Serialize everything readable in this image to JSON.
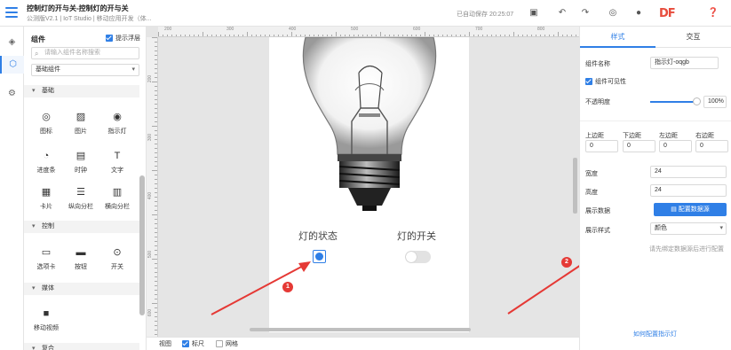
{
  "header": {
    "title": "控制灯的开与关-控制灯的开与关",
    "subtitle": "公测版V2.1 | IoT Studio | 移动应用开发（体...",
    "save_status": "已自动保存 20:25:07",
    "logo": "DF"
  },
  "component_panel": {
    "title": "组件",
    "float_tip_label": "提示浮层",
    "float_tip_checked": true,
    "search_placeholder": "请输入组件名称搜索",
    "category_select": "基础组件",
    "sections": [
      {
        "label": "基础",
        "items": [
          {
            "label": "图标",
            "icon": "target-icon"
          },
          {
            "label": "图片",
            "icon": "image-icon"
          },
          {
            "label": "指示灯",
            "icon": "indicator-icon"
          },
          {
            "label": "进度条",
            "icon": "progress-icon"
          },
          {
            "label": "时钟",
            "icon": "clock-icon"
          },
          {
            "label": "文字",
            "icon": "text-icon"
          },
          {
            "label": "卡片",
            "icon": "card-icon"
          },
          {
            "label": "纵向分栏",
            "icon": "rows-icon"
          },
          {
            "label": "横向分栏",
            "icon": "columns-icon"
          }
        ]
      },
      {
        "label": "控制",
        "items": [
          {
            "label": "选项卡",
            "icon": "tab-icon"
          },
          {
            "label": "按钮",
            "icon": "button-icon"
          },
          {
            "label": "开关",
            "icon": "switch-icon"
          }
        ]
      },
      {
        "label": "媒体",
        "items": [
          {
            "label": "移动视频",
            "icon": "video-icon"
          }
        ]
      },
      {
        "label": "复合",
        "items": []
      }
    ]
  },
  "canvas": {
    "ruler_top": [
      "200",
      "300",
      "400",
      "500",
      "600",
      "700",
      "800"
    ],
    "ruler_left": [
      "200",
      "300",
      "400",
      "500",
      "600"
    ],
    "state_label": "灯的状态",
    "switch_label": "灯的开关",
    "indicator_on": true,
    "switch_on": false,
    "badges": [
      "1",
      "2"
    ]
  },
  "bottom_bar": {
    "view_label": "视图",
    "ruler_label": "标尺",
    "ruler_checked": true,
    "grid_label": "网格",
    "grid_checked": false
  },
  "properties": {
    "tabs": [
      "样式",
      "交互"
    ],
    "active_tab": "样式",
    "component_name_label": "组件名称",
    "component_name_value": "指示灯-oqgb",
    "visible_label": "组件可见性",
    "visible_checked": true,
    "opacity_label": "不透明度",
    "opacity_value": "100%",
    "margin_labels": [
      "上边距",
      "下边距",
      "左边距",
      "右边距"
    ],
    "margin_values": [
      "0",
      "0",
      "0",
      "0"
    ],
    "width_label": "宽度",
    "width_value": "24",
    "height_label": "高度",
    "height_value": "24",
    "display_data_label": "展示数据",
    "bind_button": "配置数据源",
    "display_style_label": "展示样式",
    "display_style_value": "颜色",
    "hint": "请先绑定数据源后进行配置",
    "help_link": "如何配置指示灯"
  },
  "colors": {
    "accent": "#2f7fe6",
    "badge": "#e53935",
    "arrow": "#e53935",
    "canvas_bg": "#e5e5e5"
  }
}
